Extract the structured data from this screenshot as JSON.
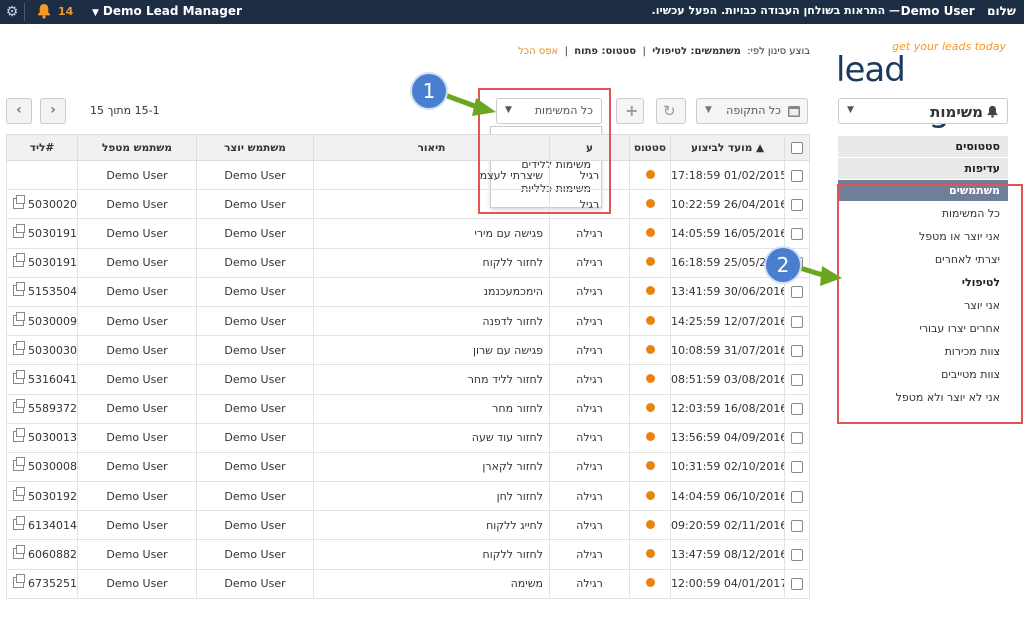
{
  "topbar": {
    "greeting": "שלום",
    "user": "Demo User",
    "notice": "— התראות בשולחן העבודה כבויות. הפעל עכשיו.",
    "account_name": "Demo Lead Manager",
    "notification_count": "14",
    "accent": "#f29a24"
  },
  "logo": {
    "tagline": "get your leads today",
    "name": "lead manager"
  },
  "filter": {
    "prefix": "בוצע סינון לפי:",
    "users": "משתמשים: לטיפולי",
    "divider": "|",
    "status": "סטטוס: פתוח",
    "clear": "אפס הכל"
  },
  "module": {
    "label": "משימות"
  },
  "sidebar": {
    "statuses": "סטטוסים",
    "priorities": "עדיפות",
    "users": "משתמשים",
    "items": [
      {
        "label": "כל המשימות",
        "bold": false
      },
      {
        "label": "אני יוצר או מטפל",
        "bold": false
      },
      {
        "label": "יצרתי לאחרים",
        "bold": false
      },
      {
        "label": "לטיפולי",
        "bold": true
      },
      {
        "label": "אני יוצר",
        "bold": false
      },
      {
        "label": "אחרים יצרו עבורי",
        "bold": false
      },
      {
        "label": "צוות מכירות",
        "bold": false
      },
      {
        "label": "צוות מטייבים",
        "bold": false
      },
      {
        "label": "אני לא יוצר ולא מטפל",
        "bold": false
      }
    ]
  },
  "toolbar": {
    "period": "כל התקופה",
    "tasks_selected": "כל המשימות",
    "tasks_options": [
      "כל המשימות",
      "משימות ללידים",
      "משימות כלליות"
    ]
  },
  "pager": {
    "range": "15-1 מתוך 15"
  },
  "callouts": {
    "one": "1",
    "two": "2"
  },
  "table": {
    "headers": {
      "due": "מועד לביצוע",
      "status": "סטטוס",
      "type": "ע",
      "description": "תיאור",
      "creator": "משתמש יוצר",
      "handler": "משתמש מטפל",
      "lead": "#ליד"
    },
    "rows": [
      {
        "due": "17:18:59 01/02/2015",
        "type": "רגיל",
        "description": "שיצרתי לעצמי",
        "creator": "Demo User",
        "handler": "Demo User",
        "lead": ""
      },
      {
        "due": "10:22:59 26/04/2016",
        "type": "רגיל",
        "description": "",
        "creator": "Demo User",
        "handler": "Demo User",
        "lead": "5030020"
      },
      {
        "due": "14:05:59 16/05/2016",
        "type": "רגילה",
        "description": "פגישה עם מירי",
        "creator": "Demo User",
        "handler": "Demo User",
        "lead": "5030191"
      },
      {
        "due": "16:18:59 25/05/2016",
        "type": "רגילה",
        "description": "לחזור ללקוח",
        "creator": "Demo User",
        "handler": "Demo User",
        "lead": "5030191"
      },
      {
        "due": "13:41:59 30/06/2016",
        "type": "רגילה",
        "description": "הימכמעכנמנ",
        "creator": "Demo User",
        "handler": "Demo User",
        "lead": "5153504"
      },
      {
        "due": "14:25:59 12/07/2016",
        "type": "רגילה",
        "description": "לחזור לדפנה",
        "creator": "Demo User",
        "handler": "Demo User",
        "lead": "5030009"
      },
      {
        "due": "10:08:59 31/07/2016",
        "type": "רגילה",
        "description": "פגישה עם שרון",
        "creator": "Demo User",
        "handler": "Demo User",
        "lead": "5030030"
      },
      {
        "due": "08:51:59 03/08/2016",
        "type": "רגילה",
        "description": "לחזור לליד מחר",
        "creator": "Demo User",
        "handler": "Demo User",
        "lead": "5316041"
      },
      {
        "due": "12:03:59 16/08/2016",
        "type": "רגילה",
        "description": "לחזור מחר",
        "creator": "Demo User",
        "handler": "Demo User",
        "lead": "5589372"
      },
      {
        "due": "13:56:59 04/09/2016",
        "type": "רגילה",
        "description": "לחזור עוד שעה",
        "creator": "Demo User",
        "handler": "Demo User",
        "lead": "5030013"
      },
      {
        "due": "10:31:59 02/10/2016",
        "type": "רגילה",
        "description": "לחזור לקארן",
        "creator": "Demo User",
        "handler": "Demo User",
        "lead": "5030008"
      },
      {
        "due": "14:04:59 06/10/2016",
        "type": "רגילה",
        "description": "לחזור לחן",
        "creator": "Demo User",
        "handler": "Demo User",
        "lead": "5030192"
      },
      {
        "due": "09:20:59 02/11/2016",
        "type": "רגילה",
        "description": "לחייג ללקוח",
        "creator": "Demo User",
        "handler": "Demo User",
        "lead": "6134014"
      },
      {
        "due": "13:47:59 08/12/2016",
        "type": "רגילה",
        "description": "לחזור ללקוח",
        "creator": "Demo User",
        "handler": "Demo User",
        "lead": "6060882"
      },
      {
        "due": "12:00:59 04/01/2017",
        "type": "רגילה",
        "description": "משימה",
        "creator": "Demo User",
        "handler": "Demo User",
        "lead": "6735251"
      }
    ]
  }
}
